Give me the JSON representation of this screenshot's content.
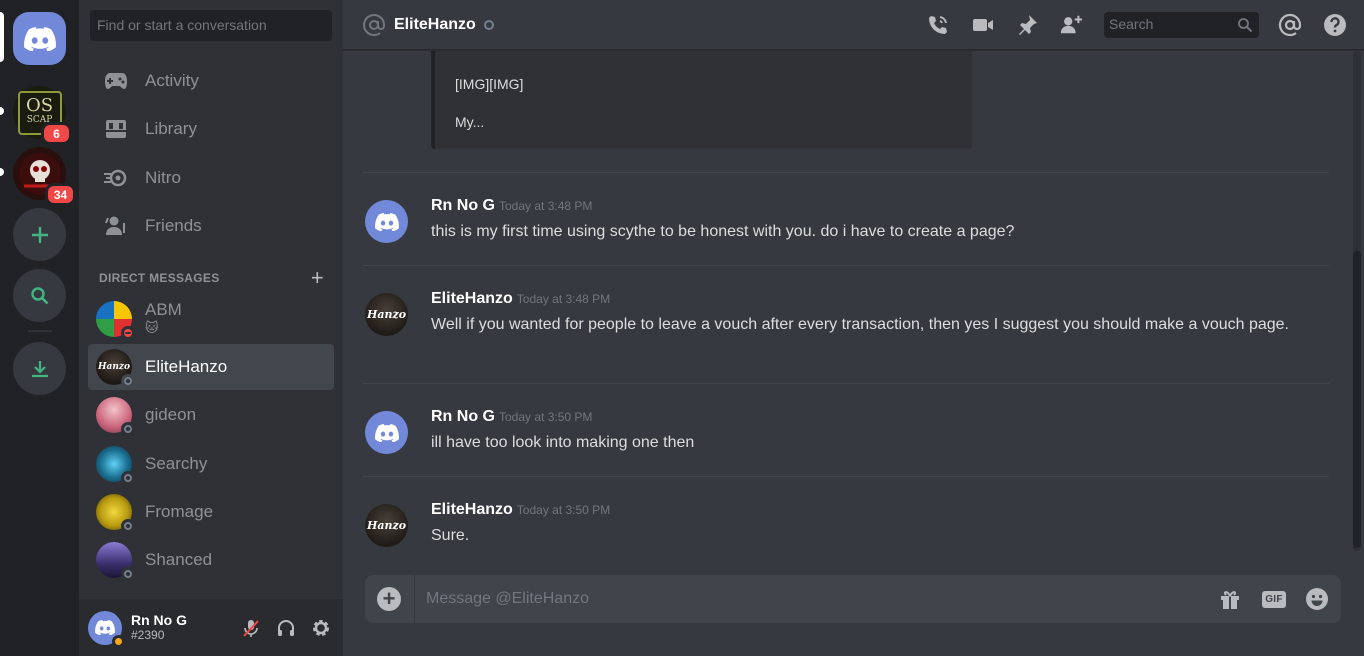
{
  "servers": {
    "home_label": "Home",
    "os_text": "OS",
    "os_sub": "SCAP",
    "os_badge": "6",
    "skull_badge": "34"
  },
  "sidebar": {
    "search_placeholder": "Find or start a conversation",
    "nav": [
      {
        "label": "Activity",
        "icon": "gamepad-icon"
      },
      {
        "label": "Library",
        "icon": "library-icon"
      },
      {
        "label": "Nitro",
        "icon": "nitro-icon"
      },
      {
        "label": "Friends",
        "icon": "friends-icon"
      }
    ],
    "dm_header": "DIRECT MESSAGES",
    "dms": [
      {
        "name": "ABM",
        "status": "dnd",
        "sub": "🐱",
        "active": false
      },
      {
        "name": "EliteHanzo",
        "status": "offline",
        "active": true
      },
      {
        "name": "gideon",
        "status": "offline",
        "active": false
      },
      {
        "name": "Searchy",
        "status": "offline",
        "active": false
      },
      {
        "name": "Fromage",
        "status": "offline",
        "active": false
      },
      {
        "name": "Shanced",
        "status": "offline",
        "active": false
      }
    ]
  },
  "user": {
    "name": "Rn No G",
    "tag": "#2390",
    "status_color": "#faa61a"
  },
  "header": {
    "title": "EliteHanzo",
    "search_placeholder": "Search"
  },
  "embed": {
    "line1": "[IMG][IMG]",
    "line2": "My..."
  },
  "messages": [
    {
      "author": "Rn No G",
      "time": "Today at 3:48 PM",
      "text": "this is my first time using scythe to be honest with you. do i have to create a page?",
      "avatar": "discord"
    },
    {
      "author": "EliteHanzo",
      "time": "Today at 3:48 PM",
      "text": "Well if you wanted for people to leave a vouch after every transaction, then yes I suggest you should make a vouch page.",
      "avatar": "hanzo"
    },
    {
      "author": "Rn No G",
      "time": "Today at 3:50 PM",
      "text": "ill have too look into making one then",
      "avatar": "discord"
    },
    {
      "author": "EliteHanzo",
      "time": "Today at 3:50 PM",
      "text": "Sure.",
      "avatar": "hanzo"
    }
  ],
  "hanzo_avatar_text": "Hanzo",
  "composer": {
    "placeholder": "Message @EliteHanzo",
    "gif_label": "GIF"
  },
  "colors": {
    "blurple": "#7289da",
    "badge_red": "#f04747",
    "green": "#43b581",
    "idle": "#faa61a"
  }
}
